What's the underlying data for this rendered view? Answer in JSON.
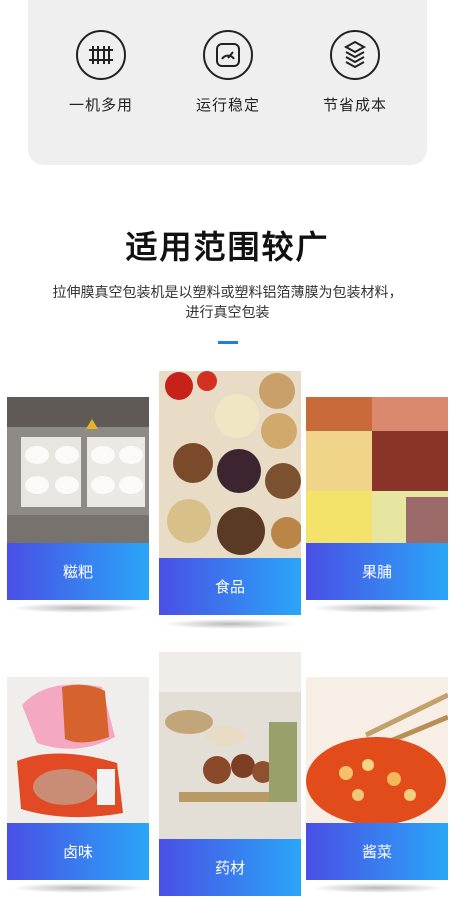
{
  "features": [
    {
      "label": "一机多用",
      "icon": "rail-track-icon"
    },
    {
      "label": "运行稳定",
      "icon": "gauge-icon"
    },
    {
      "label": "节省成本",
      "icon": "layers-icon"
    }
  ],
  "section": {
    "title": "适用范围较广",
    "description": "拉伸膜真空包装机是以塑料或塑料铝箔薄膜为包装材料，进行真空包装"
  },
  "cards": [
    {
      "label": "糍粑"
    },
    {
      "label": "食品"
    },
    {
      "label": "果脯"
    },
    {
      "label": "卤味"
    },
    {
      "label": "药材"
    },
    {
      "label": "酱菜"
    }
  ],
  "colors": {
    "accent": "#1f7fe0",
    "gradient_start": "#4a4fe6",
    "gradient_end": "#2aa6f8",
    "panel_bg": "#efefef"
  }
}
